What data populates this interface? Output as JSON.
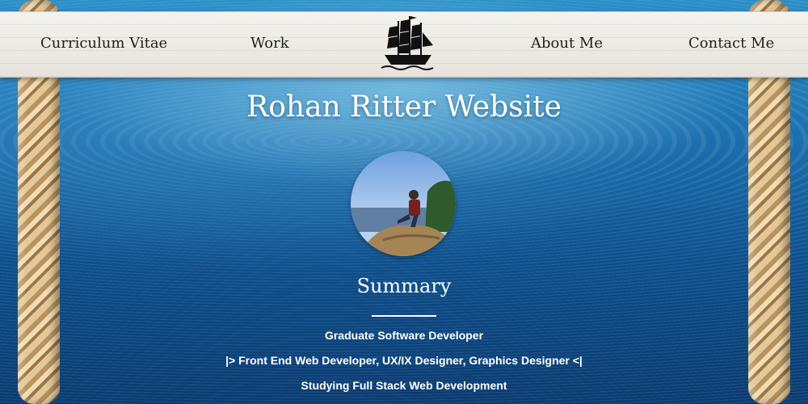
{
  "nav": {
    "items": [
      {
        "label": "Curriculum Vitae"
      },
      {
        "label": "Work"
      },
      {
        "label": "About Me"
      },
      {
        "label": "Contact Me"
      }
    ],
    "logo_icon": "sailing-ship-icon"
  },
  "hero": {
    "title": "Rohan Ritter Website",
    "avatar_icon": "profile-photo"
  },
  "summary": {
    "heading": "Summary",
    "lines": [
      "Graduate Software Developer",
      "|> Front End Web Developer, UX/IX Designer, Graphics Designer <|",
      "Studying Full Stack Web Development"
    ]
  },
  "colors": {
    "ocean_top": "#2a8fc7",
    "ocean_bottom": "#0a3b70",
    "nav_bg": "#efece7",
    "nav_text": "#1f1f1f",
    "text_light": "#ffffff"
  }
}
